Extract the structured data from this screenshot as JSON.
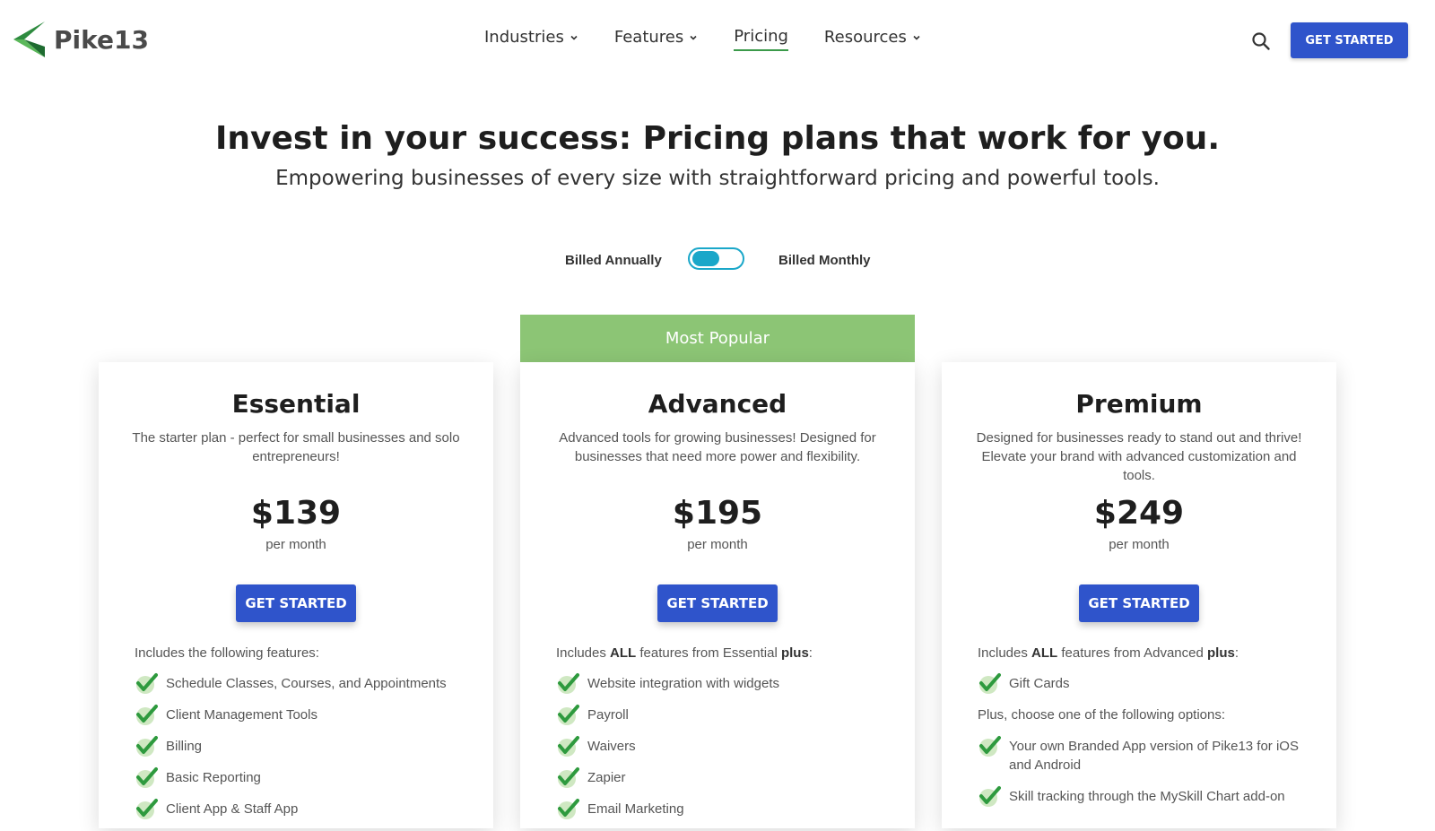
{
  "brand": {
    "name": "Pike13",
    "accent": "#3b9a4a",
    "primary": "#2f54cb"
  },
  "nav": {
    "items": [
      {
        "label": "Industries",
        "has_dropdown": true
      },
      {
        "label": "Features",
        "has_dropdown": true
      },
      {
        "label": "Pricing",
        "has_dropdown": false,
        "active": true
      },
      {
        "label": "Resources",
        "has_dropdown": true
      }
    ],
    "search_icon": "search-icon",
    "cta_label": "GET STARTED"
  },
  "hero": {
    "title": "Invest in your success: Pricing plans that work for you.",
    "subtitle": "Empowering businesses of every size with straightforward pricing and powerful tools."
  },
  "billing": {
    "annual_label": "Billed Annually",
    "monthly_label": "Billed Monthly",
    "selected": "Billed Annually",
    "toggle_color": "#1aa7c9"
  },
  "popular_label": "Most Popular",
  "popular_color": "#8cc575",
  "plans": [
    {
      "name": "Essential",
      "description": "The starter plan - perfect for small businesses and solo entrepreneurs!",
      "price": "$139",
      "period": "per month",
      "cta": "GET STARTED",
      "includes_text": "Includes the following features:",
      "features": [
        "Schedule Classes, Courses, and Appointments",
        "Client Management Tools",
        "Billing",
        "Basic Reporting",
        "Client App & Staff App"
      ]
    },
    {
      "name": "Advanced",
      "description": "Advanced tools for growing businesses! Designed for businesses that need more power and flexibility.",
      "price": "$195",
      "period": "per month",
      "cta": "GET STARTED",
      "includes_prefix": "Includes ",
      "includes_all": "ALL",
      "includes_middle": " features from Essential ",
      "includes_plus": "plus",
      "includes_suffix": ":",
      "features": [
        "Website integration with widgets",
        "Payroll",
        "Waivers",
        "Zapier",
        "Email Marketing"
      ]
    },
    {
      "name": "Premium",
      "description": "Designed for businesses ready to stand out and thrive! Elevate your brand with advanced customization and tools.",
      "price": "$249",
      "period": "per month",
      "cta": "GET STARTED",
      "includes_prefix": "Includes ",
      "includes_all": "ALL",
      "includes_middle": " features from Advanced ",
      "includes_plus": "plus",
      "includes_suffix": ":",
      "features_top": [
        "Gift Cards"
      ],
      "options_text": "Plus, choose one of the following options:",
      "features_options": [
        "Your own Branded App version of Pike13 for iOS and Android",
        "Skill tracking through the MySkill Chart add-on"
      ]
    }
  ]
}
